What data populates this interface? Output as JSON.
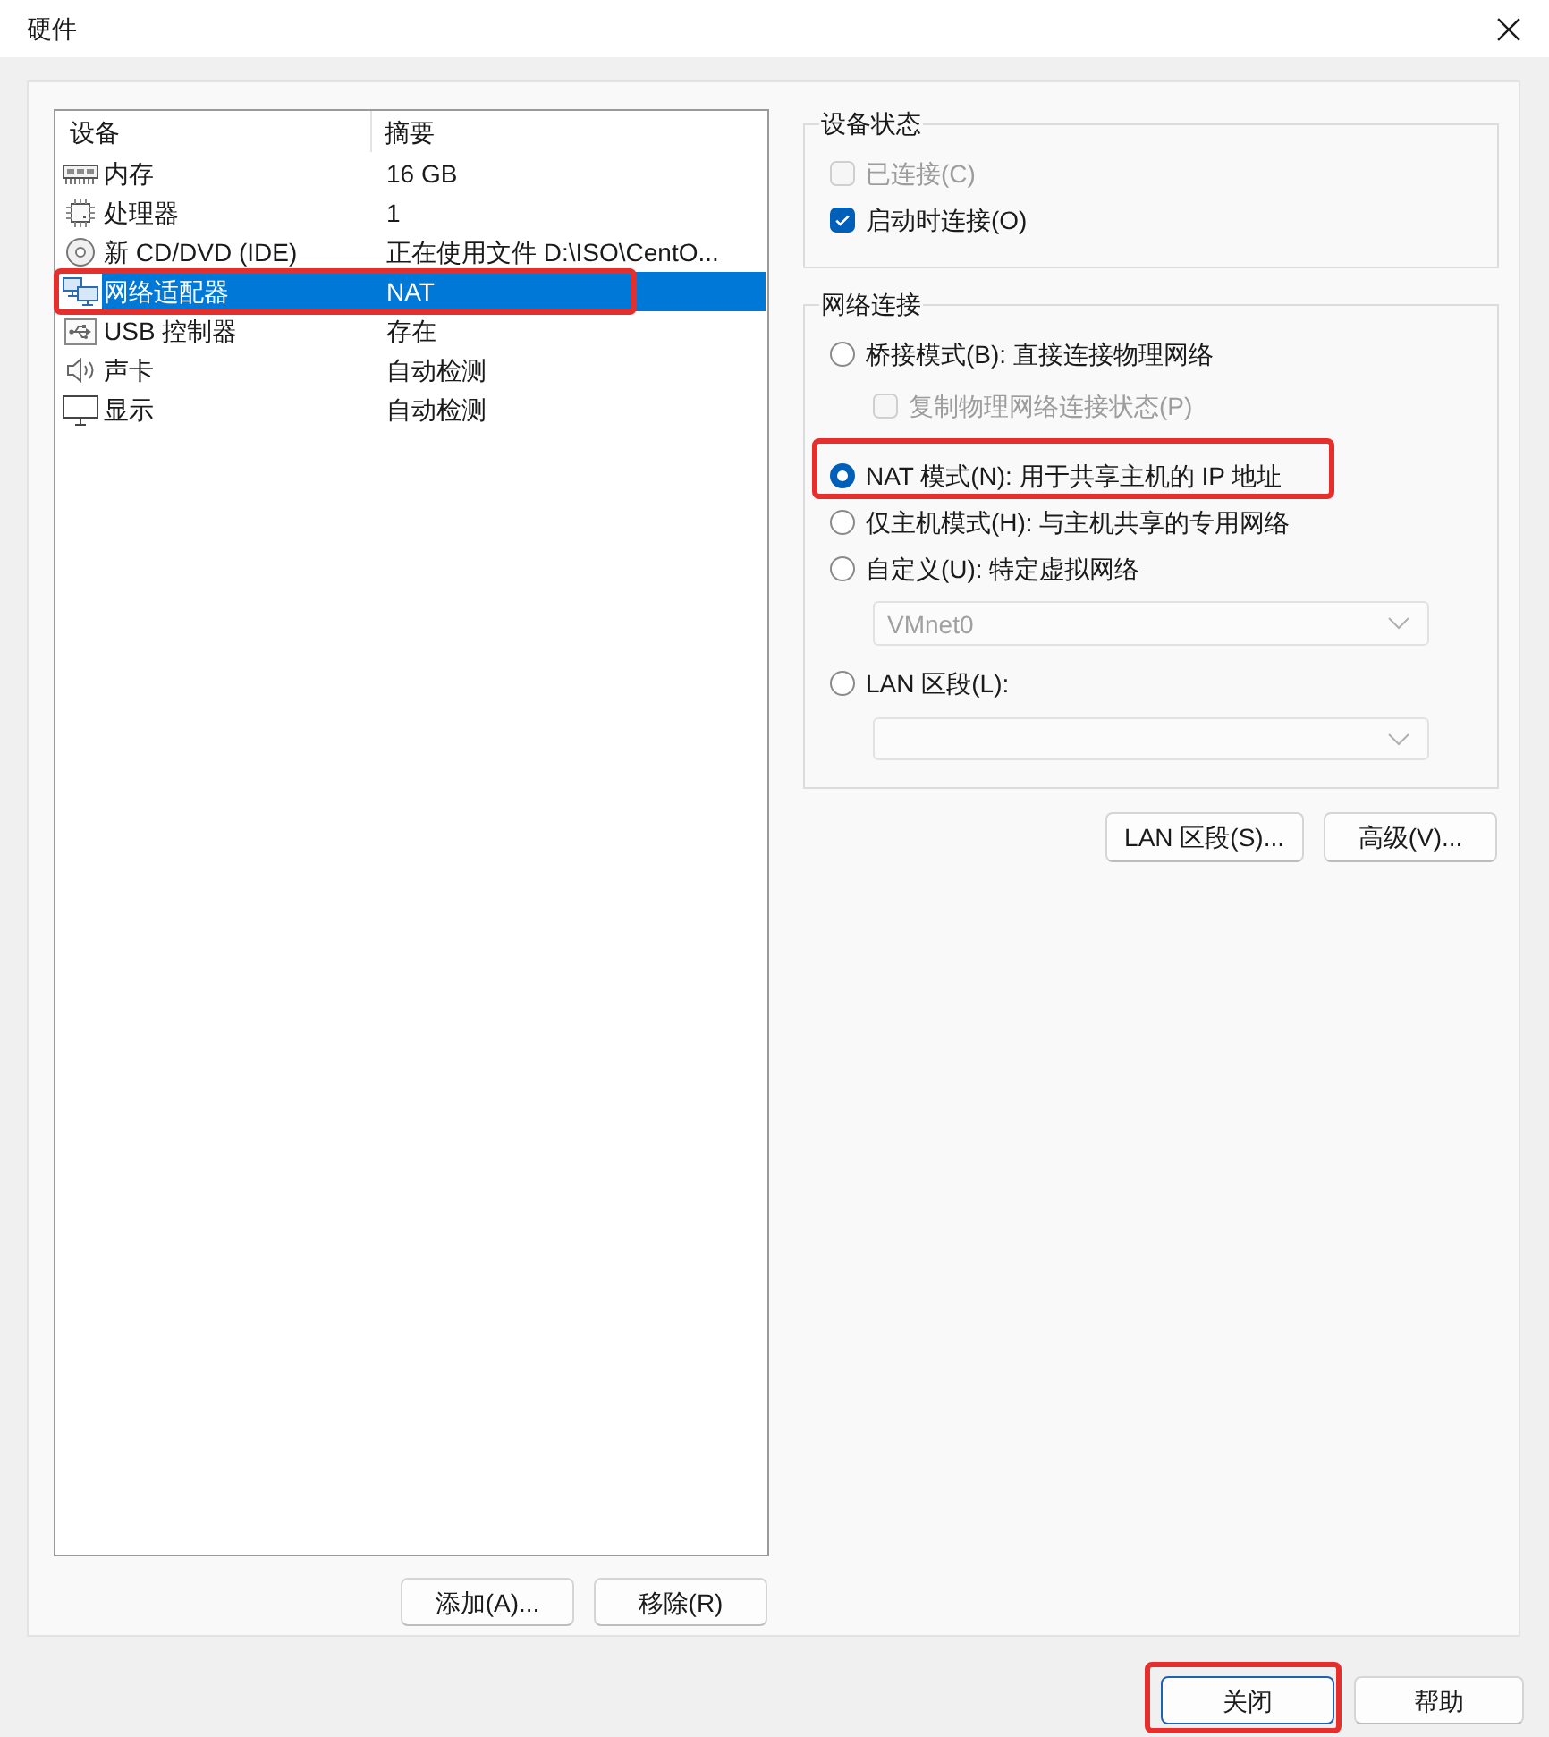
{
  "window": {
    "title": "硬件"
  },
  "device_list": {
    "columns": [
      "设备",
      "摘要"
    ],
    "devices": [
      {
        "kind": "memory",
        "name": "内存",
        "summary": "16 GB",
        "selected": false,
        "highlighted": false
      },
      {
        "kind": "cpu",
        "name": "处理器",
        "summary": "1",
        "selected": false,
        "highlighted": false
      },
      {
        "kind": "cdrom",
        "name": "新 CD/DVD (IDE)",
        "summary": "正在使用文件 D:\\ISO\\CentO...",
        "selected": false,
        "highlighted": false
      },
      {
        "kind": "network",
        "name": "网络适配器",
        "summary": "NAT",
        "selected": true,
        "highlighted": true
      },
      {
        "kind": "usb",
        "name": "USB 控制器",
        "summary": "存在",
        "selected": false,
        "highlighted": false
      },
      {
        "kind": "sound",
        "name": "声卡",
        "summary": "自动检测",
        "selected": false,
        "highlighted": false
      },
      {
        "kind": "display",
        "name": "显示",
        "summary": "自动检测",
        "selected": false,
        "highlighted": false
      }
    ]
  },
  "list_buttons": [
    {
      "label": "添加(A)..."
    },
    {
      "label": "移除(R)"
    }
  ],
  "device_status": {
    "title": "设备状态",
    "options": [
      {
        "label": "已连接(C)",
        "checked": false,
        "disabled": true
      },
      {
        "label": "启动时连接(O)",
        "checked": true,
        "disabled": false
      }
    ]
  },
  "network_connection": {
    "title": "网络连接",
    "options": [
      {
        "kind": "radio",
        "label": "桥接模式(B): 直接连接物理网络",
        "selected": false,
        "highlighted": false
      },
      {
        "kind": "checkbox",
        "label": "复制物理网络连接状态(P)",
        "checked": false,
        "disabled": true
      },
      {
        "kind": "radio",
        "label": "NAT 模式(N): 用于共享主机的 IP 地址",
        "selected": true,
        "highlighted": true
      },
      {
        "kind": "radio",
        "label": "仅主机模式(H): 与主机共享的专用网络",
        "selected": false,
        "highlighted": false
      },
      {
        "kind": "radio",
        "label": "自定义(U): 特定虚拟网络",
        "selected": false,
        "highlighted": false
      },
      {
        "kind": "dropdown",
        "value": "VMnet0",
        "disabled": true
      },
      {
        "kind": "radio",
        "label": "LAN 区段(L):",
        "selected": false,
        "highlighted": false
      },
      {
        "kind": "dropdown",
        "disabled": true
      }
    ]
  },
  "network_buttons": [
    {
      "label": "LAN 区段(S)..."
    },
    {
      "label": "高级(V)..."
    }
  ],
  "footer_buttons": [
    {
      "label": "关闭",
      "default": true,
      "highlighted": true
    },
    {
      "label": "帮助",
      "default": false,
      "highlighted": false
    }
  ]
}
